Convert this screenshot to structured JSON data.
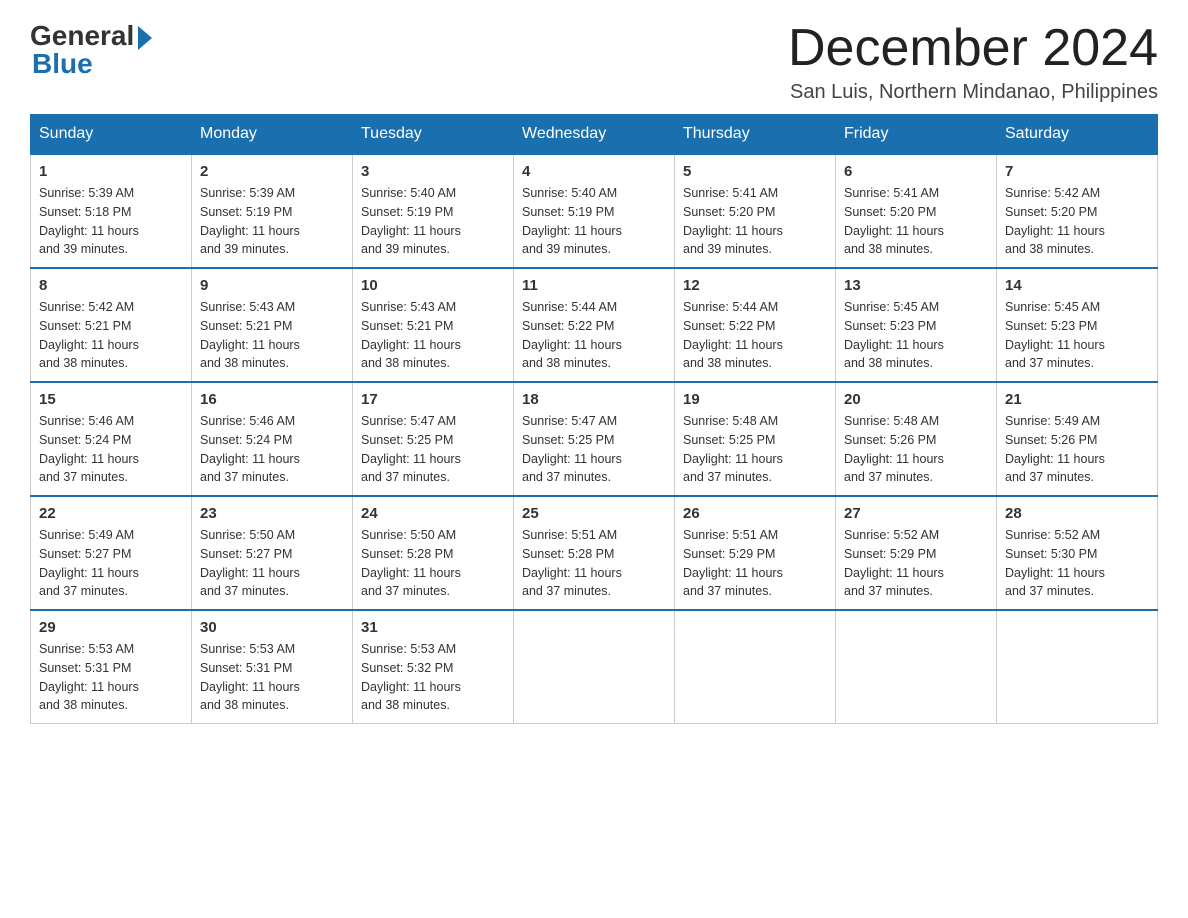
{
  "header": {
    "logo_general": "General",
    "logo_blue": "Blue",
    "month_title": "December 2024",
    "location": "San Luis, Northern Mindanao, Philippines"
  },
  "days_of_week": [
    "Sunday",
    "Monday",
    "Tuesday",
    "Wednesday",
    "Thursday",
    "Friday",
    "Saturday"
  ],
  "weeks": [
    [
      {
        "day": "1",
        "sunrise": "5:39 AM",
        "sunset": "5:18 PM",
        "daylight": "11 hours and 39 minutes."
      },
      {
        "day": "2",
        "sunrise": "5:39 AM",
        "sunset": "5:19 PM",
        "daylight": "11 hours and 39 minutes."
      },
      {
        "day": "3",
        "sunrise": "5:40 AM",
        "sunset": "5:19 PM",
        "daylight": "11 hours and 39 minutes."
      },
      {
        "day": "4",
        "sunrise": "5:40 AM",
        "sunset": "5:19 PM",
        "daylight": "11 hours and 39 minutes."
      },
      {
        "day": "5",
        "sunrise": "5:41 AM",
        "sunset": "5:20 PM",
        "daylight": "11 hours and 39 minutes."
      },
      {
        "day": "6",
        "sunrise": "5:41 AM",
        "sunset": "5:20 PM",
        "daylight": "11 hours and 38 minutes."
      },
      {
        "day": "7",
        "sunrise": "5:42 AM",
        "sunset": "5:20 PM",
        "daylight": "11 hours and 38 minutes."
      }
    ],
    [
      {
        "day": "8",
        "sunrise": "5:42 AM",
        "sunset": "5:21 PM",
        "daylight": "11 hours and 38 minutes."
      },
      {
        "day": "9",
        "sunrise": "5:43 AM",
        "sunset": "5:21 PM",
        "daylight": "11 hours and 38 minutes."
      },
      {
        "day": "10",
        "sunrise": "5:43 AM",
        "sunset": "5:21 PM",
        "daylight": "11 hours and 38 minutes."
      },
      {
        "day": "11",
        "sunrise": "5:44 AM",
        "sunset": "5:22 PM",
        "daylight": "11 hours and 38 minutes."
      },
      {
        "day": "12",
        "sunrise": "5:44 AM",
        "sunset": "5:22 PM",
        "daylight": "11 hours and 38 minutes."
      },
      {
        "day": "13",
        "sunrise": "5:45 AM",
        "sunset": "5:23 PM",
        "daylight": "11 hours and 38 minutes."
      },
      {
        "day": "14",
        "sunrise": "5:45 AM",
        "sunset": "5:23 PM",
        "daylight": "11 hours and 37 minutes."
      }
    ],
    [
      {
        "day": "15",
        "sunrise": "5:46 AM",
        "sunset": "5:24 PM",
        "daylight": "11 hours and 37 minutes."
      },
      {
        "day": "16",
        "sunrise": "5:46 AM",
        "sunset": "5:24 PM",
        "daylight": "11 hours and 37 minutes."
      },
      {
        "day": "17",
        "sunrise": "5:47 AM",
        "sunset": "5:25 PM",
        "daylight": "11 hours and 37 minutes."
      },
      {
        "day": "18",
        "sunrise": "5:47 AM",
        "sunset": "5:25 PM",
        "daylight": "11 hours and 37 minutes."
      },
      {
        "day": "19",
        "sunrise": "5:48 AM",
        "sunset": "5:25 PM",
        "daylight": "11 hours and 37 minutes."
      },
      {
        "day": "20",
        "sunrise": "5:48 AM",
        "sunset": "5:26 PM",
        "daylight": "11 hours and 37 minutes."
      },
      {
        "day": "21",
        "sunrise": "5:49 AM",
        "sunset": "5:26 PM",
        "daylight": "11 hours and 37 minutes."
      }
    ],
    [
      {
        "day": "22",
        "sunrise": "5:49 AM",
        "sunset": "5:27 PM",
        "daylight": "11 hours and 37 minutes."
      },
      {
        "day": "23",
        "sunrise": "5:50 AM",
        "sunset": "5:27 PM",
        "daylight": "11 hours and 37 minutes."
      },
      {
        "day": "24",
        "sunrise": "5:50 AM",
        "sunset": "5:28 PM",
        "daylight": "11 hours and 37 minutes."
      },
      {
        "day": "25",
        "sunrise": "5:51 AM",
        "sunset": "5:28 PM",
        "daylight": "11 hours and 37 minutes."
      },
      {
        "day": "26",
        "sunrise": "5:51 AM",
        "sunset": "5:29 PM",
        "daylight": "11 hours and 37 minutes."
      },
      {
        "day": "27",
        "sunrise": "5:52 AM",
        "sunset": "5:29 PM",
        "daylight": "11 hours and 37 minutes."
      },
      {
        "day": "28",
        "sunrise": "5:52 AM",
        "sunset": "5:30 PM",
        "daylight": "11 hours and 37 minutes."
      }
    ],
    [
      {
        "day": "29",
        "sunrise": "5:53 AM",
        "sunset": "5:31 PM",
        "daylight": "11 hours and 38 minutes."
      },
      {
        "day": "30",
        "sunrise": "5:53 AM",
        "sunset": "5:31 PM",
        "daylight": "11 hours and 38 minutes."
      },
      {
        "day": "31",
        "sunrise": "5:53 AM",
        "sunset": "5:32 PM",
        "daylight": "11 hours and 38 minutes."
      },
      null,
      null,
      null,
      null
    ]
  ],
  "labels": {
    "sunrise": "Sunrise:",
    "sunset": "Sunset:",
    "daylight": "Daylight:"
  }
}
